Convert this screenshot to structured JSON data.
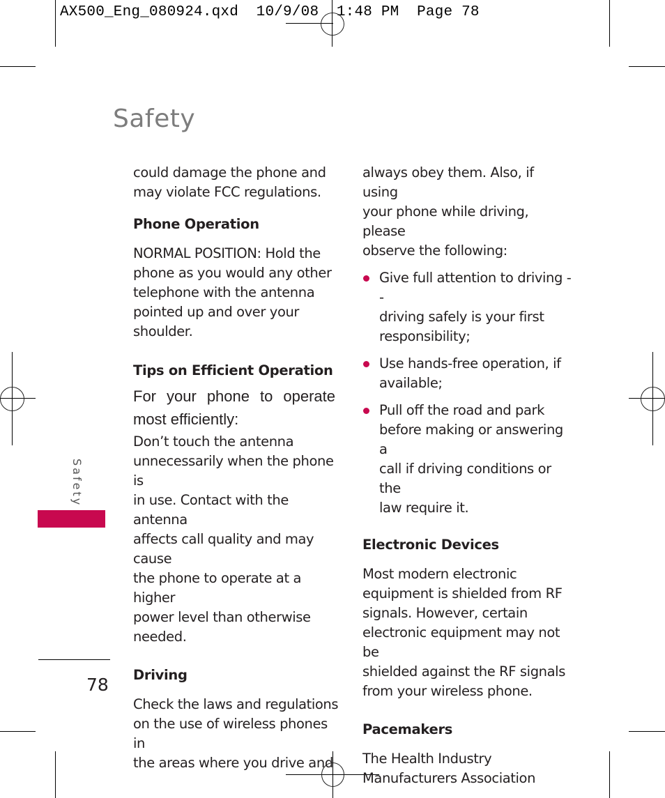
{
  "print_slug": "AX500_Eng_080924.qxd  10/9/08  1:48 PM  Page 78",
  "page": {
    "title": "Safety",
    "side_tab_label": "Safety",
    "page_number": "78",
    "accent_color": "#c8094f"
  },
  "left_column": {
    "intro": [
      "could damage the phone and",
      "may violate FCC regulations."
    ],
    "phone_operation": {
      "heading": "Phone Operation",
      "body": [
        "NORMAL POSITION: Hold the",
        "phone as you would any other",
        "telephone with the antenna",
        "pointed up and over your",
        "shoulder."
      ]
    },
    "tips": {
      "heading": "Tips on Efficient Operation",
      "lead_line1": "For your phone to operate",
      "lead_line2": "most efficiently:",
      "body": [
        "Don’t touch the antenna",
        "unnecessarily when the phone is",
        "in use. Contact with the antenna",
        "affects call quality and may cause",
        "the phone to operate at a higher",
        "power level than otherwise",
        "needed."
      ]
    },
    "driving": {
      "heading": "Driving",
      "body": [
        "Check the laws and regulations",
        "on the use of wireless phones in",
        "the areas where you drive and"
      ]
    }
  },
  "right_column": {
    "intro": [
      "always obey them. Also, if using",
      "your phone while driving, please",
      "observe the following:"
    ],
    "bullets": [
      [
        "Give full attention to driving --",
        "driving safely is your first",
        "responsibility;"
      ],
      [
        "Use hands-free operation, if",
        "available;"
      ],
      [
        "Pull off the road and park",
        "before making or answering a",
        "call if driving conditions or the",
        "law require it."
      ]
    ],
    "electronic_devices": {
      "heading": "Electronic Devices",
      "body": [
        "Most modern electronic",
        "equipment is shielded from RF",
        "signals. However, certain",
        "electronic equipment may not be",
        "shielded against the RF signals",
        "from your wireless phone."
      ]
    },
    "pacemakers": {
      "heading": "Pacemakers",
      "body": [
        "The Health Industry",
        "Manufacturers Association"
      ]
    }
  }
}
